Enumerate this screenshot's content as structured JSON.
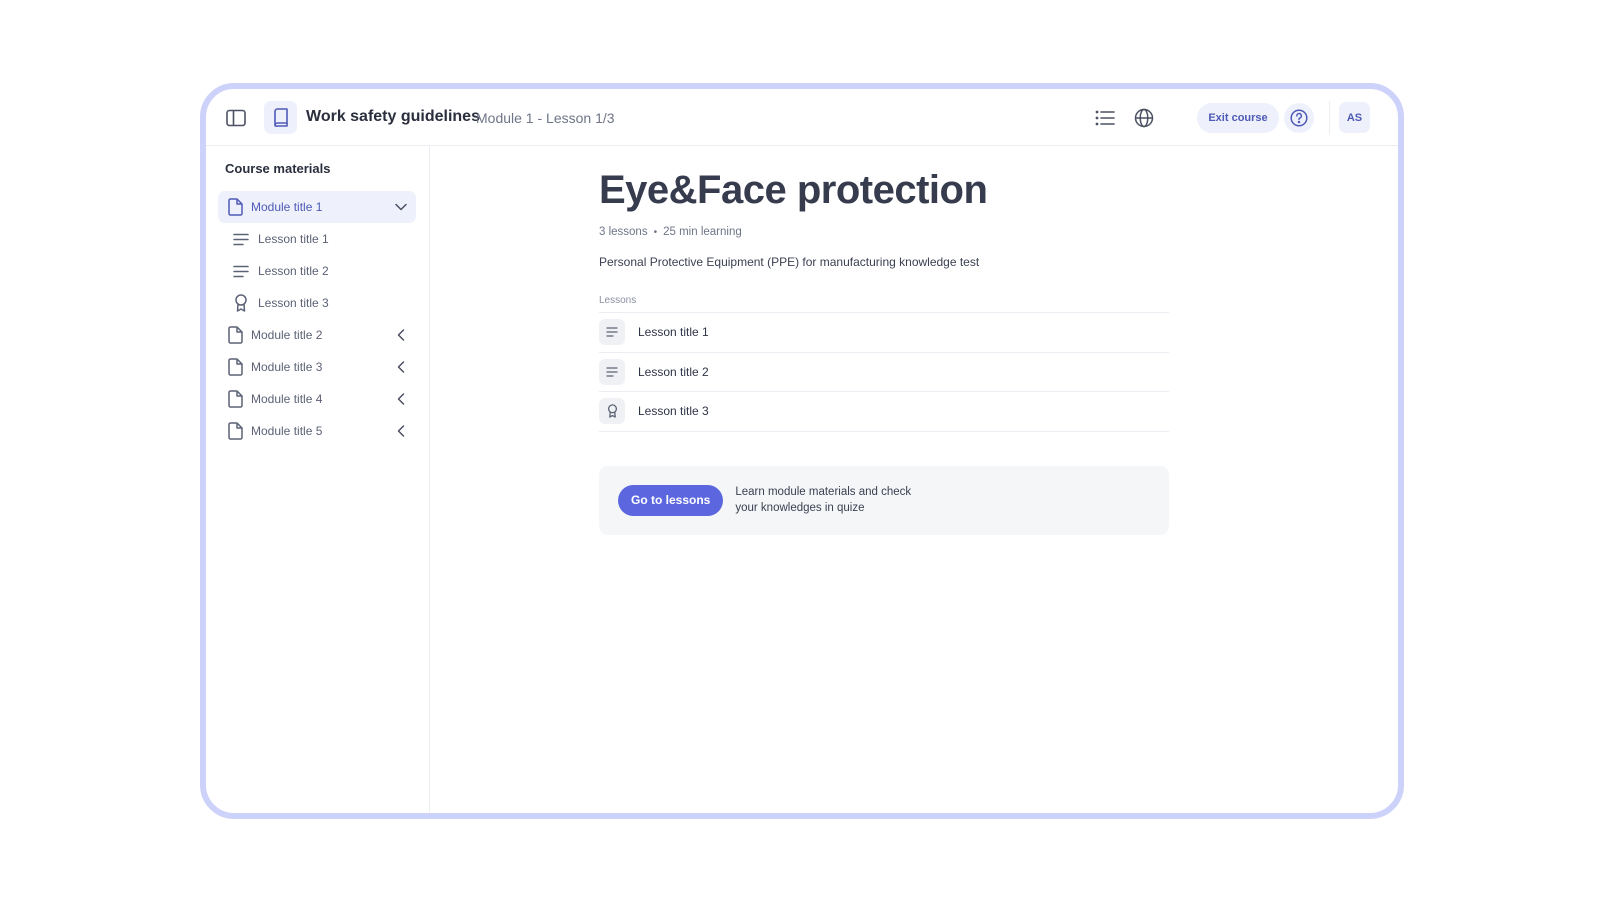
{
  "topbar": {
    "course_title": "Work safety guidelines",
    "progress": "Module 1 - Lesson 1/3",
    "exit_label": "Exit course",
    "avatar_initials": "AS"
  },
  "sidebar": {
    "heading": "Course materials",
    "modules": [
      {
        "label": "Module title 1",
        "expanded": true
      },
      {
        "label": "Module title 2",
        "expanded": false
      },
      {
        "label": "Module title 3",
        "expanded": false
      },
      {
        "label": "Module title 4",
        "expanded": false
      },
      {
        "label": "Module title 5",
        "expanded": false
      }
    ],
    "lessons": [
      {
        "label": "Lesson title 1",
        "icon": "text-lines-icon"
      },
      {
        "label": "Lesson title 2",
        "icon": "text-lines-icon"
      },
      {
        "label": "Lesson title 3",
        "icon": "award-icon"
      }
    ]
  },
  "main": {
    "title": "Eye&Face protection",
    "lesson_count": "3 lessons",
    "duration": "25 min learning",
    "description": "Personal Protective Equipment (PPE) for manufacturing knowledge test",
    "lessons_label": "Lessons",
    "lessons": [
      {
        "label": "Lesson title 1",
        "icon": "text-lines-icon"
      },
      {
        "label": "Lesson title 2",
        "icon": "text-lines-icon"
      },
      {
        "label": "Lesson title 3",
        "icon": "award-icon"
      }
    ],
    "cta": {
      "button_label": "Go to lessons",
      "text": "Learn module materials and check your knowledges in quize"
    }
  },
  "colors": {
    "accent": "#5c67df",
    "accent_soft": "#eef0fc",
    "frame": "#cdd2fb"
  }
}
